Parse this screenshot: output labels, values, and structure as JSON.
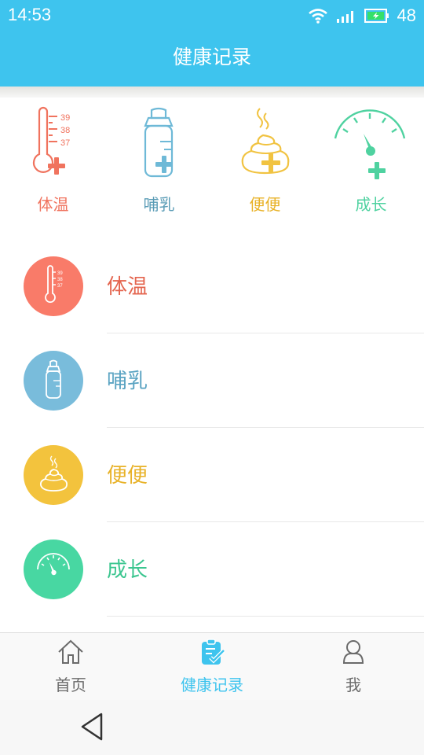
{
  "status": {
    "time": "14:53",
    "battery": "48"
  },
  "header": {
    "title": "健康记录"
  },
  "quick_add": [
    {
      "label": "体温",
      "icon": "thermometer-add-icon",
      "color": "#f0735e"
    },
    {
      "label": "哺乳",
      "icon": "bottle-add-icon",
      "color": "#6eb9d7"
    },
    {
      "label": "便便",
      "icon": "poop-add-icon",
      "color": "#f1c341"
    },
    {
      "label": "成长",
      "icon": "gauge-add-icon",
      "color": "#4fd2a0"
    }
  ],
  "thermometer_ticks": [
    "39",
    "38",
    "37"
  ],
  "records": [
    {
      "label": "体温",
      "icon": "thermometer-icon",
      "color": "#f97b69",
      "text_color": "#e4654f"
    },
    {
      "label": "哺乳",
      "icon": "bottle-icon",
      "color": "#79bcdb",
      "text_color": "#5aa3c2"
    },
    {
      "label": "便便",
      "icon": "poop-icon",
      "color": "#f3c33d",
      "text_color": "#e8b228"
    },
    {
      "label": "成长",
      "icon": "gauge-icon",
      "color": "#48d7a2",
      "text_color": "#3cc690"
    }
  ],
  "tabs": [
    {
      "label": "首页",
      "icon": "home-icon"
    },
    {
      "label": "健康记录",
      "icon": "clipboard-icon",
      "active": true
    },
    {
      "label": "我",
      "icon": "person-icon"
    }
  ],
  "colors": {
    "primary": "#3ec4ee",
    "tab_inactive": "#6b6b6b"
  }
}
